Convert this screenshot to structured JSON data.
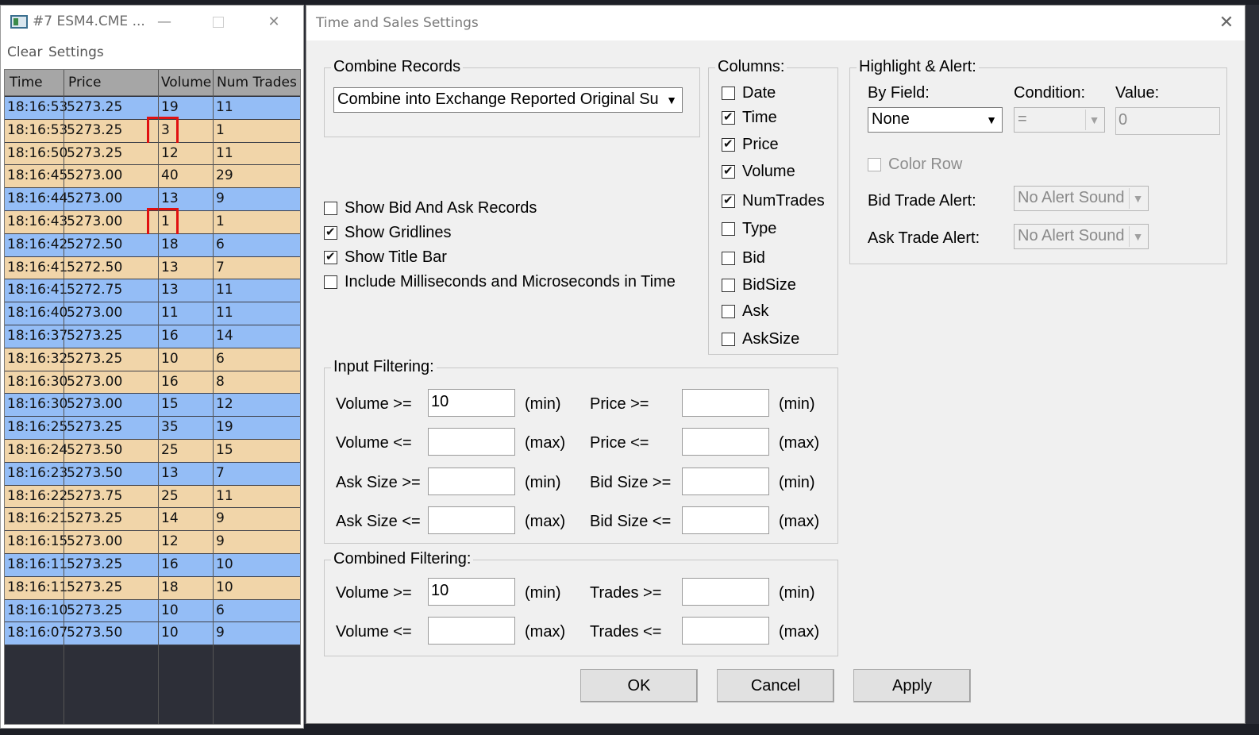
{
  "ts_window": {
    "title": "#7 ESM4.CME ...",
    "minimize": "—",
    "close": "✕",
    "menu": {
      "clear": "Clear",
      "settings": "Settings"
    },
    "columns": [
      "Time",
      "Price",
      "Volume",
      "Num Trades"
    ],
    "rows": [
      {
        "time": "18:16:53",
        "price": "5273.25",
        "volume": "19",
        "trades": "11",
        "side": "bid"
      },
      {
        "time": "18:16:53",
        "price": "5273.25",
        "volume": "3",
        "trades": "1",
        "side": "ask"
      },
      {
        "time": "18:16:50",
        "price": "5273.25",
        "volume": "12",
        "trades": "11",
        "side": "ask"
      },
      {
        "time": "18:16:45",
        "price": "5273.00",
        "volume": "40",
        "trades": "29",
        "side": "ask"
      },
      {
        "time": "18:16:44",
        "price": "5273.00",
        "volume": "13",
        "trades": "9",
        "side": "bid"
      },
      {
        "time": "18:16:43",
        "price": "5273.00",
        "volume": "1",
        "trades": "1",
        "side": "ask"
      },
      {
        "time": "18:16:42",
        "price": "5272.50",
        "volume": "18",
        "trades": "6",
        "side": "bid"
      },
      {
        "time": "18:16:41",
        "price": "5272.50",
        "volume": "13",
        "trades": "7",
        "side": "ask"
      },
      {
        "time": "18:16:41",
        "price": "5272.75",
        "volume": "13",
        "trades": "11",
        "side": "bid"
      },
      {
        "time": "18:16:40",
        "price": "5273.00",
        "volume": "11",
        "trades": "11",
        "side": "bid"
      },
      {
        "time": "18:16:37",
        "price": "5273.25",
        "volume": "16",
        "trades": "14",
        "side": "bid"
      },
      {
        "time": "18:16:32",
        "price": "5273.25",
        "volume": "10",
        "trades": "6",
        "side": "ask"
      },
      {
        "time": "18:16:30",
        "price": "5273.00",
        "volume": "16",
        "trades": "8",
        "side": "ask"
      },
      {
        "time": "18:16:30",
        "price": "5273.00",
        "volume": "15",
        "trades": "12",
        "side": "bid"
      },
      {
        "time": "18:16:25",
        "price": "5273.25",
        "volume": "35",
        "trades": "19",
        "side": "bid"
      },
      {
        "time": "18:16:24",
        "price": "5273.50",
        "volume": "25",
        "trades": "15",
        "side": "ask"
      },
      {
        "time": "18:16:23",
        "price": "5273.50",
        "volume": "13",
        "trades": "7",
        "side": "bid"
      },
      {
        "time": "18:16:22",
        "price": "5273.75",
        "volume": "25",
        "trades": "11",
        "side": "ask"
      },
      {
        "time": "18:16:21",
        "price": "5273.25",
        "volume": "14",
        "trades": "9",
        "side": "ask"
      },
      {
        "time": "18:16:15",
        "price": "5273.00",
        "volume": "12",
        "trades": "9",
        "side": "ask"
      },
      {
        "time": "18:16:11",
        "price": "5273.25",
        "volume": "16",
        "trades": "10",
        "side": "bid"
      },
      {
        "time": "18:16:11",
        "price": "5273.25",
        "volume": "18",
        "trades": "10",
        "side": "ask"
      },
      {
        "time": "18:16:10",
        "price": "5273.25",
        "volume": "10",
        "trades": "6",
        "side": "bid"
      },
      {
        "time": "18:16:07",
        "price": "5273.50",
        "volume": "10",
        "trades": "9",
        "side": "bid"
      }
    ],
    "highlighted_rows": [
      1,
      5
    ],
    "colors": {
      "bid_row": "#94bdf6",
      "ask_row": "#f1d5a9",
      "highlight": "#e01010"
    }
  },
  "dialog": {
    "title": "Time and Sales Settings",
    "close": "✕",
    "combine_records": {
      "label": "Combine Records",
      "selected": "Combine into Exchange Reported Original Summary"
    },
    "options": [
      {
        "label": "Show Bid And Ask Records",
        "checked": false
      },
      {
        "label": "Show Gridlines",
        "checked": true
      },
      {
        "label": "Show Title Bar",
        "checked": true
      },
      {
        "label": "Include Milliseconds and Microseconds in Time",
        "checked": false
      }
    ],
    "columns": {
      "label": "Columns:",
      "items": [
        {
          "label": "Date",
          "checked": false
        },
        {
          "label": "Time",
          "checked": true
        },
        {
          "label": "Price",
          "checked": true
        },
        {
          "label": "Volume",
          "checked": true
        },
        {
          "label": "NumTrades",
          "checked": true
        },
        {
          "label": "Type",
          "checked": false
        },
        {
          "label": "Bid",
          "checked": false
        },
        {
          "label": "BidSize",
          "checked": false
        },
        {
          "label": "Ask",
          "checked": false
        },
        {
          "label": "AskSize",
          "checked": false
        }
      ]
    },
    "highlight": {
      "label": "Highlight & Alert:",
      "by_field_label": "By Field:",
      "by_field_value": "None",
      "condition_label": "Condition:",
      "condition_value": "=",
      "value_label": "Value:",
      "value_value": "0",
      "color_row": "Color Row",
      "bid_alert_label": "Bid Trade Alert:",
      "bid_alert_value": "No Alert Sound",
      "ask_alert_label": "Ask Trade Alert:",
      "ask_alert_value": "No Alert Sound"
    },
    "input_filtering": {
      "label": "Input Filtering:",
      "fields": [
        {
          "label": "Volume >=",
          "value": "10",
          "suffix": "(min)"
        },
        {
          "label": "Volume <=",
          "value": "",
          "suffix": "(max)"
        },
        {
          "label": "Ask Size >=",
          "value": "",
          "suffix": "(min)"
        },
        {
          "label": "Ask Size <=",
          "value": "",
          "suffix": "(max)"
        },
        {
          "label": "Price >=",
          "value": "",
          "suffix": "(min)"
        },
        {
          "label": "Price <=",
          "value": "",
          "suffix": "(max)"
        },
        {
          "label": "Bid Size >=",
          "value": "",
          "suffix": "(min)"
        },
        {
          "label": "Bid Size <=",
          "value": "",
          "suffix": "(max)"
        }
      ]
    },
    "combined_filtering": {
      "label": "Combined Filtering:",
      "fields": [
        {
          "label": "Volume >=",
          "value": "10",
          "suffix": "(min)"
        },
        {
          "label": "Volume <=",
          "value": "",
          "suffix": "(max)"
        },
        {
          "label": "Trades >=",
          "value": "",
          "suffix": "(min)"
        },
        {
          "label": "Trades <=",
          "value": "",
          "suffix": "(max)"
        }
      ]
    },
    "buttons": {
      "ok": "OK",
      "cancel": "Cancel",
      "apply": "Apply"
    }
  }
}
